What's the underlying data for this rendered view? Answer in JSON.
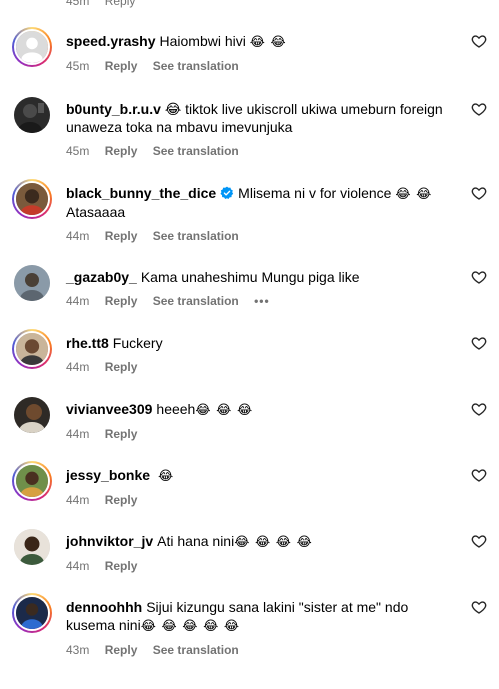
{
  "top_cut": {
    "time": "45m",
    "reply": "Reply"
  },
  "comments": [
    {
      "username": "speed.yrashy",
      "verified": false,
      "text": "Haiombwi hivi",
      "emoji": "😂 😂",
      "time": "45m",
      "reply": "Reply",
      "translate": "See translation",
      "avatar_ring": true,
      "avatar_icon": "default-avatar"
    },
    {
      "username": "b0unty_b.r.u.v",
      "verified": false,
      "text": "😂 tiktok live ukiscroll ukiwa umeburn foreign unaweza toka na mbavu imevunjuka",
      "emoji": "",
      "time": "45m",
      "reply": "Reply",
      "translate": "See translation",
      "avatar_ring": false,
      "avatar_icon": "dark-portrait-avatar"
    },
    {
      "username": "black_bunny_the_dice",
      "verified": true,
      "text": "Mlisema ni v for violence",
      "emoji": "😂 😂",
      "text2": "Atasaaaa",
      "time": "44m",
      "reply": "Reply",
      "translate": "See translation",
      "avatar_ring": true,
      "avatar_icon": "profile-photo-avatar"
    },
    {
      "username": "_gazab0y_",
      "verified": false,
      "text": "Kama unaheshimu Mungu piga like",
      "emoji": "",
      "time": "44m",
      "reply": "Reply",
      "translate": "See translation",
      "more": "•••",
      "avatar_ring": false,
      "avatar_icon": "profile-photo-avatar"
    },
    {
      "username": "rhe.tt8",
      "verified": false,
      "text": "Fuckery",
      "emoji": "",
      "time": "44m",
      "reply": "Reply",
      "avatar_ring": true,
      "avatar_icon": "profile-photo-avatar"
    },
    {
      "username": "vivianvee309",
      "verified": false,
      "text": "heeeh",
      "emoji": "😂 😂 😂",
      "time": "44m",
      "reply": "Reply",
      "avatar_ring": false,
      "avatar_icon": "profile-photo-avatar"
    },
    {
      "username": "jessy_bonke",
      "verified": false,
      "text": "",
      "emoji": "😂",
      "time": "44m",
      "reply": "Reply",
      "avatar_ring": true,
      "avatar_icon": "profile-photo-avatar"
    },
    {
      "username": "johnviktor_jv",
      "verified": false,
      "text": "Ati hana nini",
      "emoji": "😂 😂 😂 😂",
      "time": "44m",
      "reply": "Reply",
      "avatar_ring": false,
      "avatar_icon": "profile-photo-avatar"
    },
    {
      "username": "dennoohhh",
      "verified": false,
      "text": "Sijui kizungu sana lakini \"sister at me\" ndo kusema nini",
      "emoji": "😂 😂 😂 😂 😂",
      "time": "43m",
      "reply": "Reply",
      "translate": "See translation",
      "avatar_ring": true,
      "avatar_icon": "profile-photo-avatar"
    }
  ],
  "colors": {
    "meta_text": "#737373",
    "verified_blue": "#0095f6",
    "ring_start": "#feda75",
    "ring_end": "#962fbf"
  }
}
